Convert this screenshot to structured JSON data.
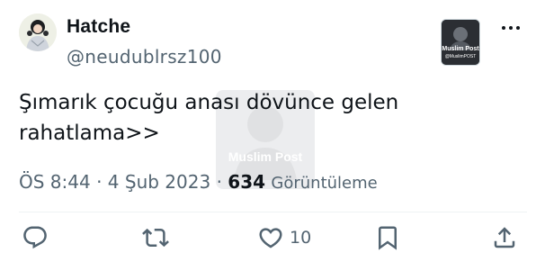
{
  "tweet": {
    "display_name": "Hatche",
    "handle": "@neudublrsz100",
    "text_line1": "Şımarık çocuğu anası dövünce gelen",
    "text_line2": "rahatlama>>",
    "time": "ÖS 8:44",
    "separator": "·",
    "date": "4 Şub 2023",
    "views_count": "634",
    "views_label": "Görüntüleme"
  },
  "embed": {
    "caption_line1": "Muslim Post",
    "caption_line2": "@MuslimPOST"
  },
  "watermark": {
    "text": "Muslim Post"
  },
  "actions": {
    "reply": {
      "icon": "reply-icon"
    },
    "retweet": {
      "icon": "retweet-icon"
    },
    "like": {
      "icon": "heart-icon",
      "count": "10"
    },
    "bookmark": {
      "icon": "bookmark-icon"
    },
    "share": {
      "icon": "share-icon"
    }
  },
  "colors": {
    "primary_text": "#0f1419",
    "secondary_text": "#536471",
    "divider": "#eff3f4"
  }
}
